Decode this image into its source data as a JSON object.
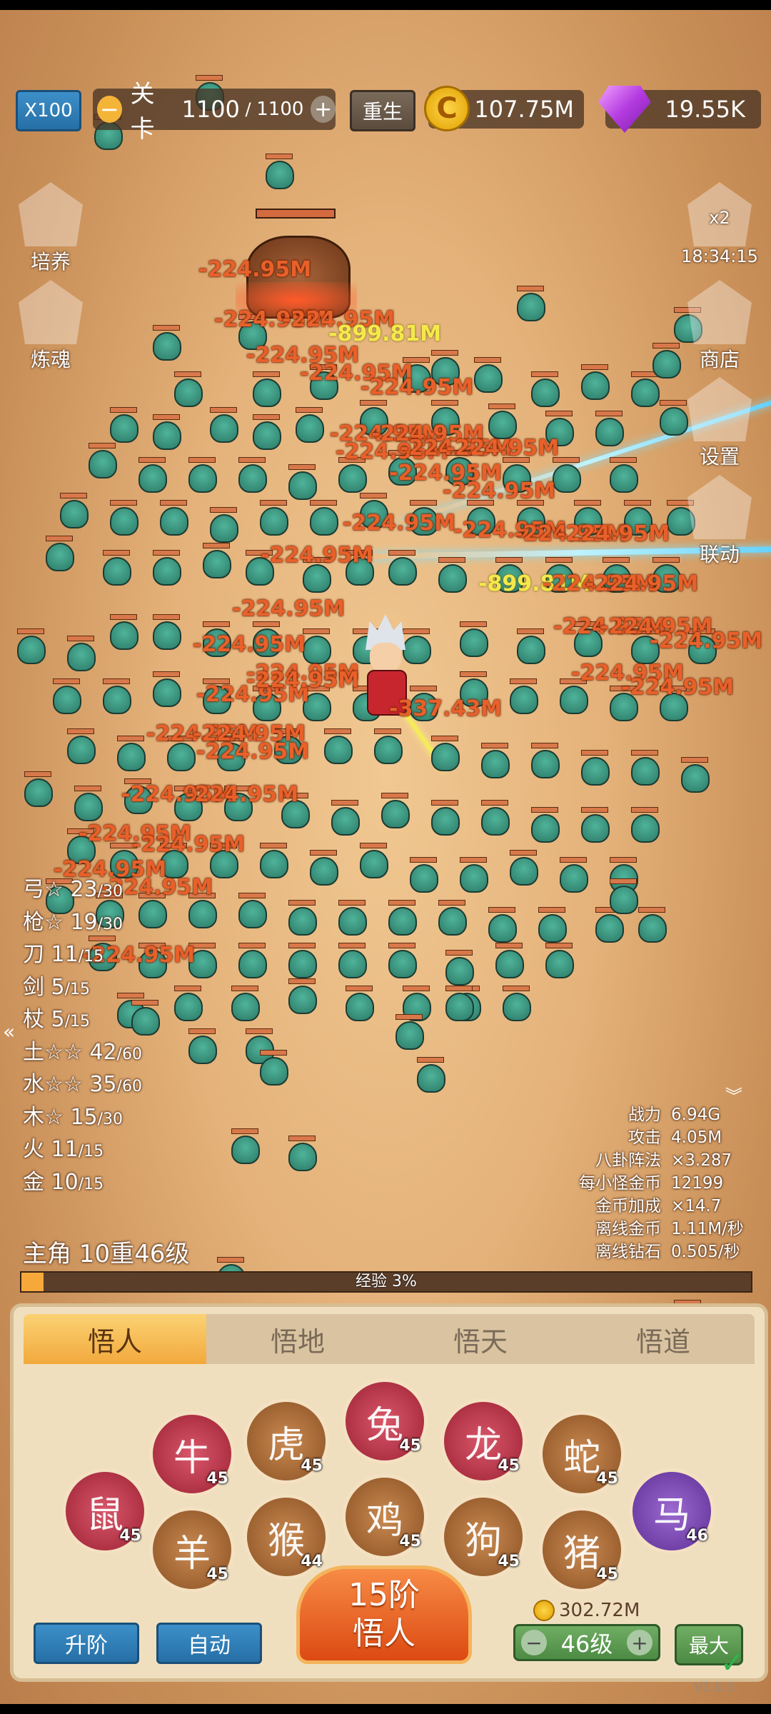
{
  "top": {
    "speed": "X100",
    "stage_prefix": "关卡",
    "stage_current": "1100",
    "stage_sep": " / ",
    "stage_total": "1100",
    "rebirth": "重生",
    "gold": "107.75M",
    "gems": "19.55K"
  },
  "left_menu": {
    "cultivate": "培养",
    "refine": "炼魂"
  },
  "right_menu": {
    "multiplier": "x2",
    "timer": "18:34:15",
    "shop": "商店",
    "settings": "设置",
    "link": "联动"
  },
  "weapons": [
    {
      "name": "弓☆",
      "cur": "23",
      "max": "/30"
    },
    {
      "name": "枪☆",
      "cur": "19",
      "max": "/30"
    },
    {
      "name": "刀",
      "cur": "11",
      "max": "/15"
    },
    {
      "name": "剑",
      "cur": "5",
      "max": "/15"
    },
    {
      "name": "杖",
      "cur": "5",
      "max": "/15"
    },
    {
      "name": "土☆☆",
      "cur": "42",
      "max": "/60"
    },
    {
      "name": "水☆☆",
      "cur": "35",
      "max": "/60"
    },
    {
      "name": "木☆",
      "cur": "15",
      "max": "/30"
    },
    {
      "name": "火",
      "cur": "11",
      "max": "/15"
    },
    {
      "name": "金",
      "cur": "10",
      "max": "/15"
    }
  ],
  "stats": [
    {
      "label": "战力",
      "value": "6.94G"
    },
    {
      "label": "攻击",
      "value": "4.05M"
    },
    {
      "label": "八卦阵法",
      "value": "×3.287"
    },
    {
      "label": "每小怪金币",
      "value": "12199"
    },
    {
      "label": "金币加成",
      "value": "×14.7"
    },
    {
      "label": "离线金币",
      "value": "1.11M/秒"
    },
    {
      "label": "离线钻石",
      "value": "0.505/秒"
    }
  ],
  "hero": {
    "title": "主角 10重46级",
    "exp_label": "经验 3%",
    "exp_percent": 3
  },
  "damage": {
    "normal": "-224.95M",
    "crit": "-899.81M",
    "hit": "-337.43M"
  },
  "panel": {
    "tabs": [
      "悟人",
      "悟地",
      "悟天",
      "悟道"
    ],
    "zodiac_levels": [
      "45",
      "45",
      "45",
      "45",
      "44",
      "45",
      "45",
      "45",
      "45",
      "45",
      "45",
      "46"
    ],
    "zodiac_names": [
      "鼠",
      "牛",
      "羊",
      "虎",
      "猴",
      "兔",
      "鸡",
      "龙",
      "狗",
      "蛇",
      "猪",
      "马"
    ],
    "upgrade_btn": "升阶",
    "auto_btn": "自动",
    "main_btn_line1": "15阶",
    "main_btn_line2": "悟人",
    "cost": "302.72M",
    "level": "46级",
    "minus": "−",
    "plus": "+",
    "max_btn": "最大",
    "version": "V1.0.5"
  },
  "colors": {
    "damage": "#e8602a",
    "crit": "#f4e94a",
    "exp_fill": "#f6a93a"
  }
}
